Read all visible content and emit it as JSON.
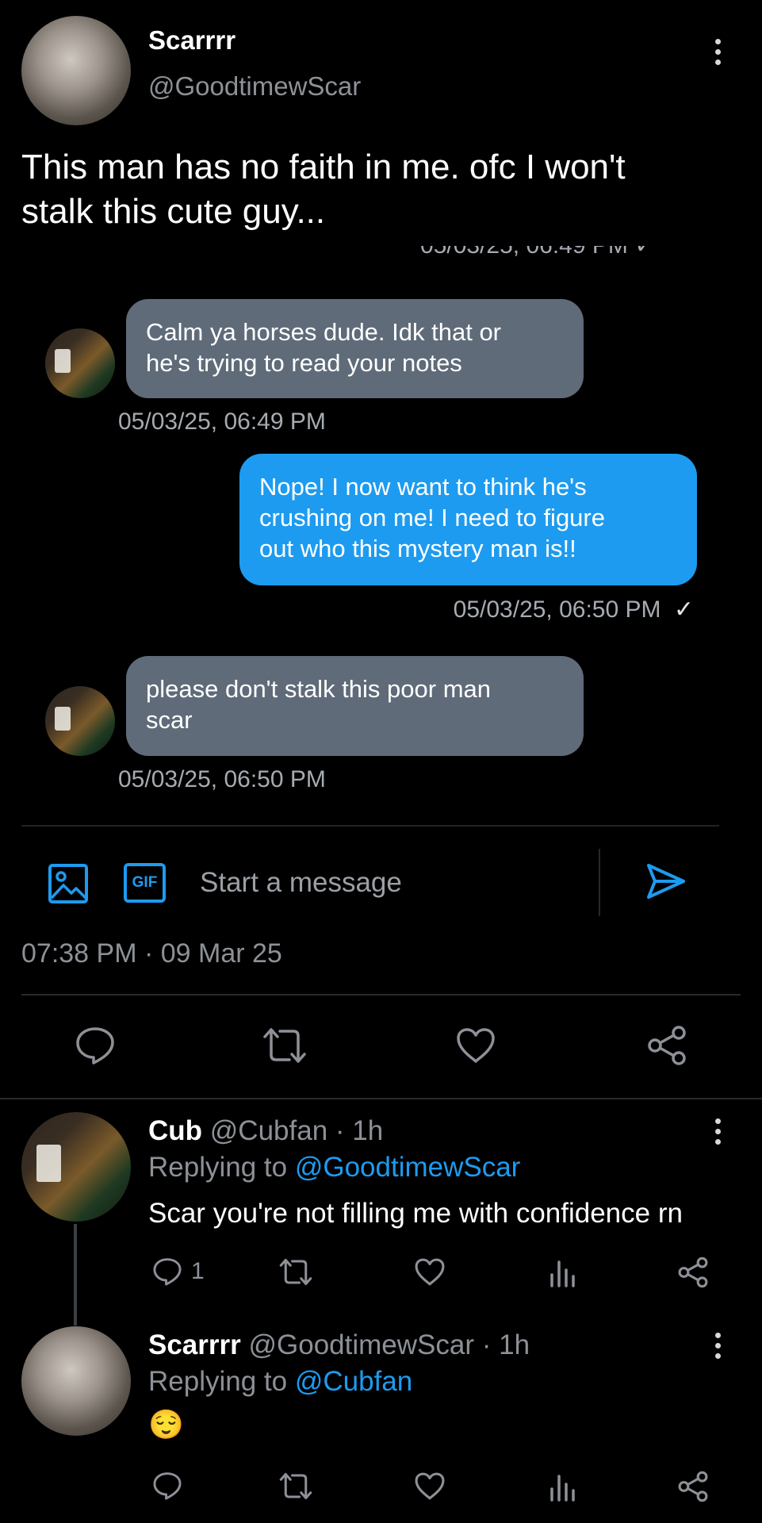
{
  "tweet": {
    "author_name": "Scarrrr",
    "author_handle": "@GoodtimewScar",
    "text_line1": "This man has no faith in me. ofc I won't",
    "text_line2": "stalk this cute guy...",
    "timestamp": "07:38 PM · 09 Mar 25"
  },
  "dm": {
    "cut_timestamp": "05/03/25, 06:49 PM ✓",
    "messages": [
      {
        "side": "in",
        "line1": "Calm ya horses dude. Idk that or",
        "line2": "he's trying to read your notes",
        "time": "05/03/25, 06:49 PM"
      },
      {
        "side": "out",
        "line1": "Nope! I now want to think he's",
        "line2": "crushing on me! I need to figure",
        "line3": "out who this mystery man is!!",
        "time": "05/03/25, 06:50 PM",
        "check": "✓"
      },
      {
        "side": "in",
        "line1": "please don't stalk this poor man",
        "line2": "scar",
        "time": "05/03/25, 06:50 PM"
      }
    ],
    "composer": {
      "placeholder": "Start a message",
      "gif_label": "GIF"
    }
  },
  "actions": [
    "reply-icon",
    "retweet-icon",
    "like-icon",
    "share-icon"
  ],
  "replies": [
    {
      "name": "Cub",
      "handle": "@Cubfan",
      "time": "· 1h",
      "replying_prefix": "Replying to ",
      "replying_to": "@GoodtimewScar",
      "text": "Scar you're not filling me with confidence rn",
      "reply_count": "1"
    },
    {
      "name": "Scarrrr",
      "handle": "@GoodtimewScar",
      "time": "· 1h",
      "replying_prefix": "Replying to ",
      "replying_to": "@Cubfan",
      "text": "😌"
    }
  ],
  "colors": {
    "accent": "#1d9bf0",
    "bubble_in": "#5f6b79",
    "background": "#000000"
  }
}
